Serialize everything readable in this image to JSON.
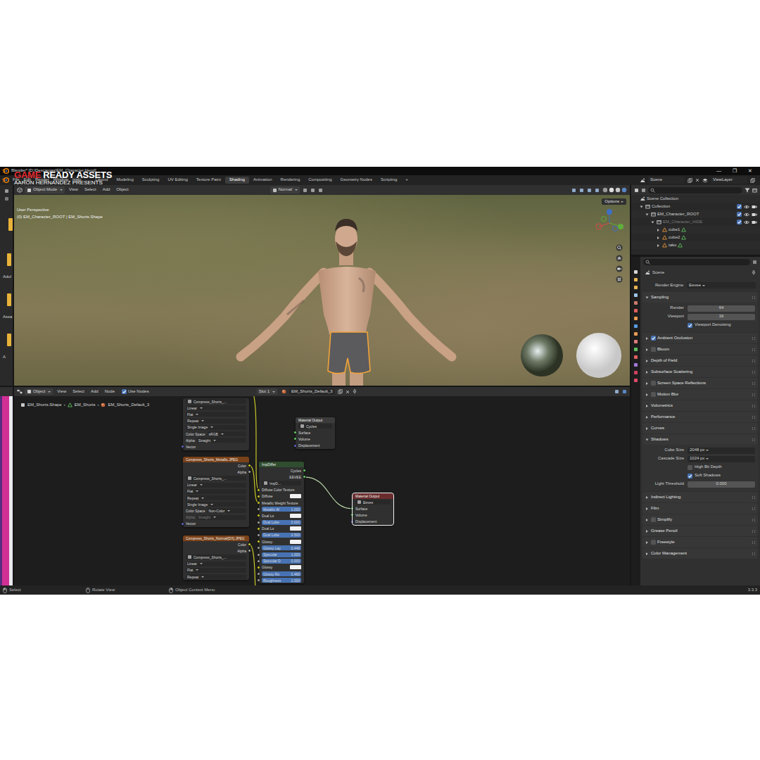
{
  "watermark": {
    "accent": "GAME",
    "title": "READY ASSETS",
    "subtitle": "AARON HERNANDEZ PRESENTS"
  },
  "window": {
    "title": "Blender* [D:\\Descargas\\EM_Character.blend]",
    "controls": [
      "—",
      "❐",
      "✕"
    ]
  },
  "menus": [
    "File",
    "Edit",
    "Render",
    "Window",
    "Help"
  ],
  "workspaces": [
    {
      "label": "Layout",
      "selected": false
    },
    {
      "label": "Modeling",
      "selected": false
    },
    {
      "label": "Sculpting",
      "selected": false
    },
    {
      "label": "UV Editing",
      "selected": false
    },
    {
      "label": "Texture Paint",
      "selected": false
    },
    {
      "label": "Shading",
      "selected": true
    },
    {
      "label": "Animation",
      "selected": false
    },
    {
      "label": "Rendering",
      "selected": false
    },
    {
      "label": "Compositing",
      "selected": false
    },
    {
      "label": "Geometry Nodes",
      "selected": false
    },
    {
      "label": "Scripting",
      "selected": false
    }
  ],
  "workspace_add": "+",
  "scene_selector": {
    "scene": "Scene",
    "view_layer": "ViewLayer"
  },
  "file_strip": {
    "items": [
      "Adol",
      "Assa",
      "A"
    ]
  },
  "viewport": {
    "header": {
      "mode": "Object Mode",
      "menus": [
        "View",
        "Select",
        "Add",
        "Object"
      ],
      "orientation": "Normal"
    },
    "title": "User Perspective",
    "context": "(0) EM_Character_ROOT | EM_Shorts.Shape",
    "options": "Options"
  },
  "outliner": {
    "items": [
      {
        "label": "Scene Collection",
        "kind": "scene_collection",
        "dimmed": false,
        "children": [
          {
            "label": "Collection",
            "kind": "collection",
            "expanded": true,
            "dimmed": false,
            "checked": true,
            "visible": true,
            "renderable": true,
            "children": [
              {
                "label": "EM_Character_ROOT",
                "kind": "collection",
                "expanded": true,
                "dimmed": false,
                "checked": true,
                "visible": true,
                "renderable": true,
                "children": [
                  {
                    "label": "EM_Character_HIDE",
                    "kind": "collection",
                    "expanded": true,
                    "dimmed": true,
                    "checked": true,
                    "visible": true,
                    "renderable": true,
                    "children": [
                      {
                        "label": "cube1",
                        "kind": "object",
                        "expanded": false,
                        "dimmed": false,
                        "children": []
                      },
                      {
                        "label": "cube2",
                        "kind": "object",
                        "expanded": false,
                        "dimmed": false,
                        "children": []
                      },
                      {
                        "label": "tako",
                        "kind": "object",
                        "expanded": false,
                        "dimmed": false,
                        "children": []
                      }
                    ]
                  }
                ]
              }
            ]
          }
        ]
      }
    ]
  },
  "properties": {
    "tab": "Scene",
    "engine": {
      "label": "Render Engine",
      "value": "Eevee"
    },
    "panels": [
      {
        "label": "Sampling",
        "kind": "plain",
        "expanded": true,
        "rows": [
          {
            "kind": "field",
            "label": "Render",
            "value": "64"
          },
          {
            "kind": "field",
            "label": "Viewport",
            "value": "16"
          },
          {
            "kind": "check",
            "label": "Viewport Denoising",
            "checked": true
          }
        ]
      },
      {
        "label": "Ambient Occlusion",
        "kind": "toggle",
        "checked": true,
        "expanded": false
      },
      {
        "label": "Bloom",
        "kind": "toggle",
        "checked": false,
        "expanded": false
      },
      {
        "label": "Depth of Field",
        "kind": "plain",
        "expanded": false
      },
      {
        "label": "Subsurface Scattering",
        "kind": "plain",
        "expanded": false
      },
      {
        "label": "Screen Space Reflections",
        "kind": "toggle",
        "checked": false,
        "expanded": false
      },
      {
        "label": "Motion Blur",
        "kind": "toggle",
        "checked": false,
        "expanded": false
      },
      {
        "label": "Volumetrics",
        "kind": "plain",
        "expanded": false
      },
      {
        "label": "Performance",
        "kind": "plain",
        "expanded": false
      },
      {
        "label": "Curves",
        "kind": "plain",
        "expanded": false
      },
      {
        "label": "Shadows",
        "kind": "plain",
        "expanded": true,
        "rows": [
          {
            "kind": "select",
            "label": "Cube Size",
            "value": "2048 px"
          },
          {
            "kind": "select",
            "label": "Cascade Size",
            "value": "1024 px"
          },
          {
            "kind": "check",
            "label": "High Bit Depth",
            "checked": false
          },
          {
            "kind": "check",
            "label": "Soft Shadows",
            "checked": true
          },
          {
            "kind": "field",
            "label": "Light Threshold",
            "value": "0.000"
          }
        ]
      },
      {
        "label": "Indirect Lighting",
        "kind": "plain",
        "expanded": false
      },
      {
        "label": "Film",
        "kind": "plain",
        "expanded": false
      },
      {
        "label": "Simplify",
        "kind": "toggle",
        "checked": false,
        "expanded": false
      },
      {
        "label": "Grease Pencil",
        "kind": "plain",
        "expanded": false
      },
      {
        "label": "Freestyle",
        "kind": "toggle",
        "checked": false,
        "expanded": false
      },
      {
        "label": "Color Management",
        "kind": "plain",
        "expanded": false
      }
    ]
  },
  "node_editor": {
    "header": {
      "type": "Object",
      "menus": [
        "View",
        "Select",
        "Add",
        "Node"
      ],
      "use_nodes": {
        "label": "Use Nodes",
        "checked": true
      },
      "slot": "Slot 1",
      "material": "EM_Shorts_Default_3"
    },
    "breadcrumbs": {
      "items": [
        "EM_Shorts.Shape",
        "EM_Shorts",
        "EM_Shorts_Default_3"
      ],
      "separator": "›"
    },
    "nodes": [
      {
        "kind": "image",
        "selected": false,
        "rows": [
          {
            "kind": "select",
            "value": "Compress_Shorts_..."
          },
          {
            "kind": "menu",
            "value": "Linear"
          },
          {
            "kind": "menu",
            "value": "Flat"
          },
          {
            "kind": "menu",
            "value": "Repeat"
          },
          {
            "kind": "menu",
            "value": "Single Image"
          },
          {
            "kind": "prop",
            "label": "Color Space",
            "value": "sRGB",
            "dimmed": false
          },
          {
            "kind": "prop",
            "label": "Alpha",
            "value": "Straight",
            "dimmed": false
          },
          {
            "kind": "in",
            "label": "Vector",
            "color": "#6363c7"
          }
        ]
      },
      {
        "kind": "image",
        "selected": false,
        "title": "Compress_Shorts_Metallic.JPEG",
        "rows": [
          {
            "kind": "out",
            "label": "Color",
            "color": "#c7c729"
          },
          {
            "kind": "out",
            "label": "Alpha",
            "color": "#a1a1a1"
          },
          {
            "kind": "select",
            "value": "Compress_Shorts_..."
          },
          {
            "kind": "menu",
            "value": "Linear"
          },
          {
            "kind": "menu",
            "value": "Flat"
          },
          {
            "kind": "menu",
            "value": "Repeat"
          },
          {
            "kind": "menu",
            "value": "Single Image"
          },
          {
            "kind": "prop",
            "label": "Color Space",
            "value": "Non-Color",
            "dimmed": false
          },
          {
            "kind": "prop",
            "label": "Alpha",
            "value": "Straight",
            "dimmed": true
          },
          {
            "kind": "in",
            "label": "Vector",
            "color": "#6363c7"
          }
        ]
      },
      {
        "kind": "image",
        "selected": false,
        "title": "Compress_Shorts_Normal(DX).JPEG",
        "rows": [
          {
            "kind": "out",
            "label": "Color",
            "color": "#c7c729"
          },
          {
            "kind": "out",
            "label": "Alpha",
            "color": "#a1a1a1"
          },
          {
            "kind": "select",
            "value": "Compress_Shorts_..."
          },
          {
            "kind": "menu",
            "value": "Linear"
          },
          {
            "kind": "menu",
            "value": "Flat"
          },
          {
            "kind": "menu",
            "value": "Repeat"
          }
        ]
      },
      {
        "kind": "group",
        "selected": false,
        "title": "ImpDiffer",
        "rows": [
          {
            "kind": "out",
            "label": "Cycles",
            "color": "#63c763"
          },
          {
            "kind": "out",
            "label": "EEVEE",
            "color": "#63c763"
          },
          {
            "kind": "select",
            "value": "ImpD..."
          },
          {
            "kind": "in",
            "label": "Diffuse Color Texture",
            "color": "#c7c729"
          },
          {
            "kind": "swatch",
            "label": "Diffuse",
            "color": "#c7c729"
          },
          {
            "kind": "in",
            "label": "Metallic Weight Texture",
            "color": "#c7c729"
          },
          {
            "kind": "field",
            "label": "Metallic W",
            "value": "1.000",
            "color": "#a1a1a1"
          },
          {
            "kind": "swatch",
            "label": "Dual Lo",
            "color": "#c7c729"
          },
          {
            "kind": "field",
            "label": "Dual Lobe",
            "value": "0.000",
            "color": "#a1a1a1"
          },
          {
            "kind": "swatch",
            "label": "Dual Lo",
            "color": "#c7c729"
          },
          {
            "kind": "field",
            "label": "Dual Lobe",
            "value": "0.500",
            "color": "#a1a1a1"
          },
          {
            "kind": "swatch",
            "label": "Glossy",
            "color": "#c7c729"
          },
          {
            "kind": "field",
            "label": "Glossy Lay",
            "value": "0.448",
            "color": "#a1a1a1"
          },
          {
            "kind": "field",
            "label": "Specular",
            "value": "1.000",
            "color": "#a1a1a1"
          },
          {
            "kind": "field",
            "label": "Specular D",
            "value": "0.000",
            "color": "#a1a1a1"
          },
          {
            "kind": "swatch",
            "label": "Glossy",
            "color": "#c7c729"
          },
          {
            "kind": "field",
            "label": "Glossy Ro",
            "value": "0.469",
            "color": "#a1a1a1"
          },
          {
            "kind": "field",
            "label": "Roughness",
            "value": "1.000",
            "color": "#a1a1a1"
          }
        ]
      },
      {
        "kind": "output",
        "selected": false,
        "title": "Material Output",
        "rows": [
          {
            "kind": "select",
            "value": "Cycles"
          },
          {
            "kind": "in",
            "label": "Surface",
            "color": "#63c763"
          },
          {
            "kind": "in",
            "label": "Volume",
            "color": "#63c763"
          },
          {
            "kind": "in",
            "label": "Displacement",
            "color": "#6363c7"
          }
        ]
      },
      {
        "kind": "output",
        "selected": true,
        "title": "Material Output",
        "rows": [
          {
            "kind": "select",
            "value": "Eevee"
          },
          {
            "kind": "in",
            "label": "Surface",
            "color": "#63c763"
          },
          {
            "kind": "in",
            "label": "Volume",
            "color": "#63c763"
          },
          {
            "kind": "in",
            "label": "Displacement",
            "color": "#6363c7"
          }
        ]
      }
    ]
  },
  "status_bar": {
    "items": [
      "Select",
      "Rotate View",
      "Object Context Menu"
    ],
    "version": "3.3.3"
  }
}
